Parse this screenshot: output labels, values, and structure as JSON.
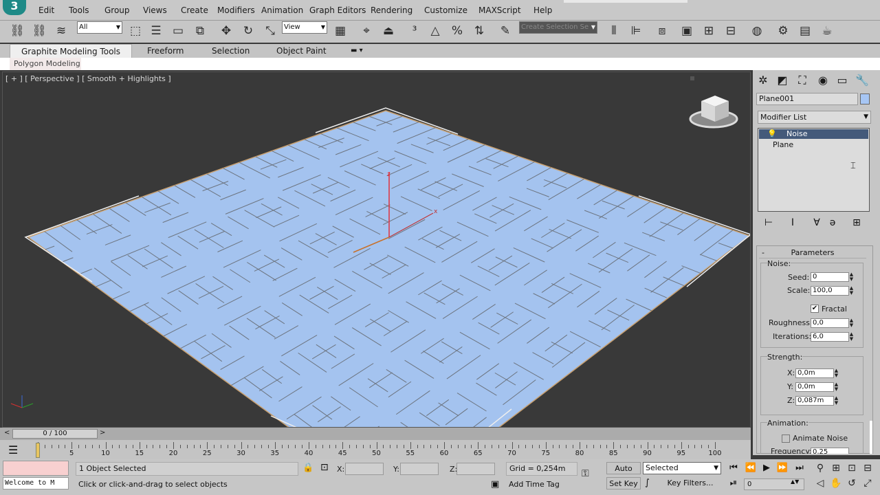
{
  "menu": {
    "logo": "3",
    "items": [
      "Edit",
      "Tools",
      "Group",
      "Views",
      "Create",
      "Modifiers",
      "Animation",
      "Graph Editors",
      "Rendering",
      "Customize",
      "MAXScript",
      "Help"
    ]
  },
  "toolbar": {
    "filter_value": "All",
    "refcoord_value": "View",
    "selection_set_placeholder": "Create Selection Se"
  },
  "ribbon": {
    "tabs": [
      "Graphite Modeling Tools",
      "Freeform",
      "Selection",
      "Object Paint"
    ],
    "panel_label": "Polygon Modeling"
  },
  "viewport": {
    "label": "[ + ] [ Perspective ] [ Smooth + Highlights ]",
    "plane_color": "#a4c3ef",
    "axis_z": "z",
    "axis_x": "x"
  },
  "command_panel": {
    "object_name": "Plane001",
    "object_color": "#a7c6f4",
    "modifier_list_label": "Modifier List",
    "stack": [
      "Noise",
      "Plane"
    ],
    "parameters": {
      "title": "Parameters",
      "noise_group": "Noise:",
      "seed_label": "Seed:",
      "seed": "0",
      "scale_label": "Scale:",
      "scale": "100,0",
      "fractal_label": "Fractal",
      "roughness_label": "Roughness:",
      "roughness": "0,0",
      "iterations_label": "Iterations:",
      "iterations": "6,0",
      "strength_group": "Strength:",
      "x_label": "X:",
      "x": "0,0m",
      "y_label": "Y:",
      "y": "0,0m",
      "z_label": "Z:",
      "z": "0,087m",
      "animation_group": "Animation:",
      "animate_noise_label": "Animate Noise",
      "frequency_label": "Frequency:",
      "frequency": "0,25"
    }
  },
  "timeline": {
    "slider_text": "0 / 100",
    "ticks": [
      "5",
      "10",
      "15",
      "20",
      "25",
      "30",
      "35",
      "40",
      "45",
      "50",
      "55",
      "60",
      "65",
      "70",
      "75",
      "80",
      "85",
      "90",
      "95",
      "100"
    ]
  },
  "status": {
    "listener_text": "Welcome to M",
    "selection_text": "1 Object Selected",
    "prompt": "Click or click-and-drag to select objects",
    "x_label": "X:",
    "y_label": "Y:",
    "z_label": "Z:",
    "grid": "Grid = 0,254m",
    "add_time_tag": "Add Time Tag",
    "auto_key": "Auto Key",
    "set_key": "Set Key",
    "key_mode": "Selected",
    "key_filters": "Key Filters...",
    "frame": "0"
  }
}
